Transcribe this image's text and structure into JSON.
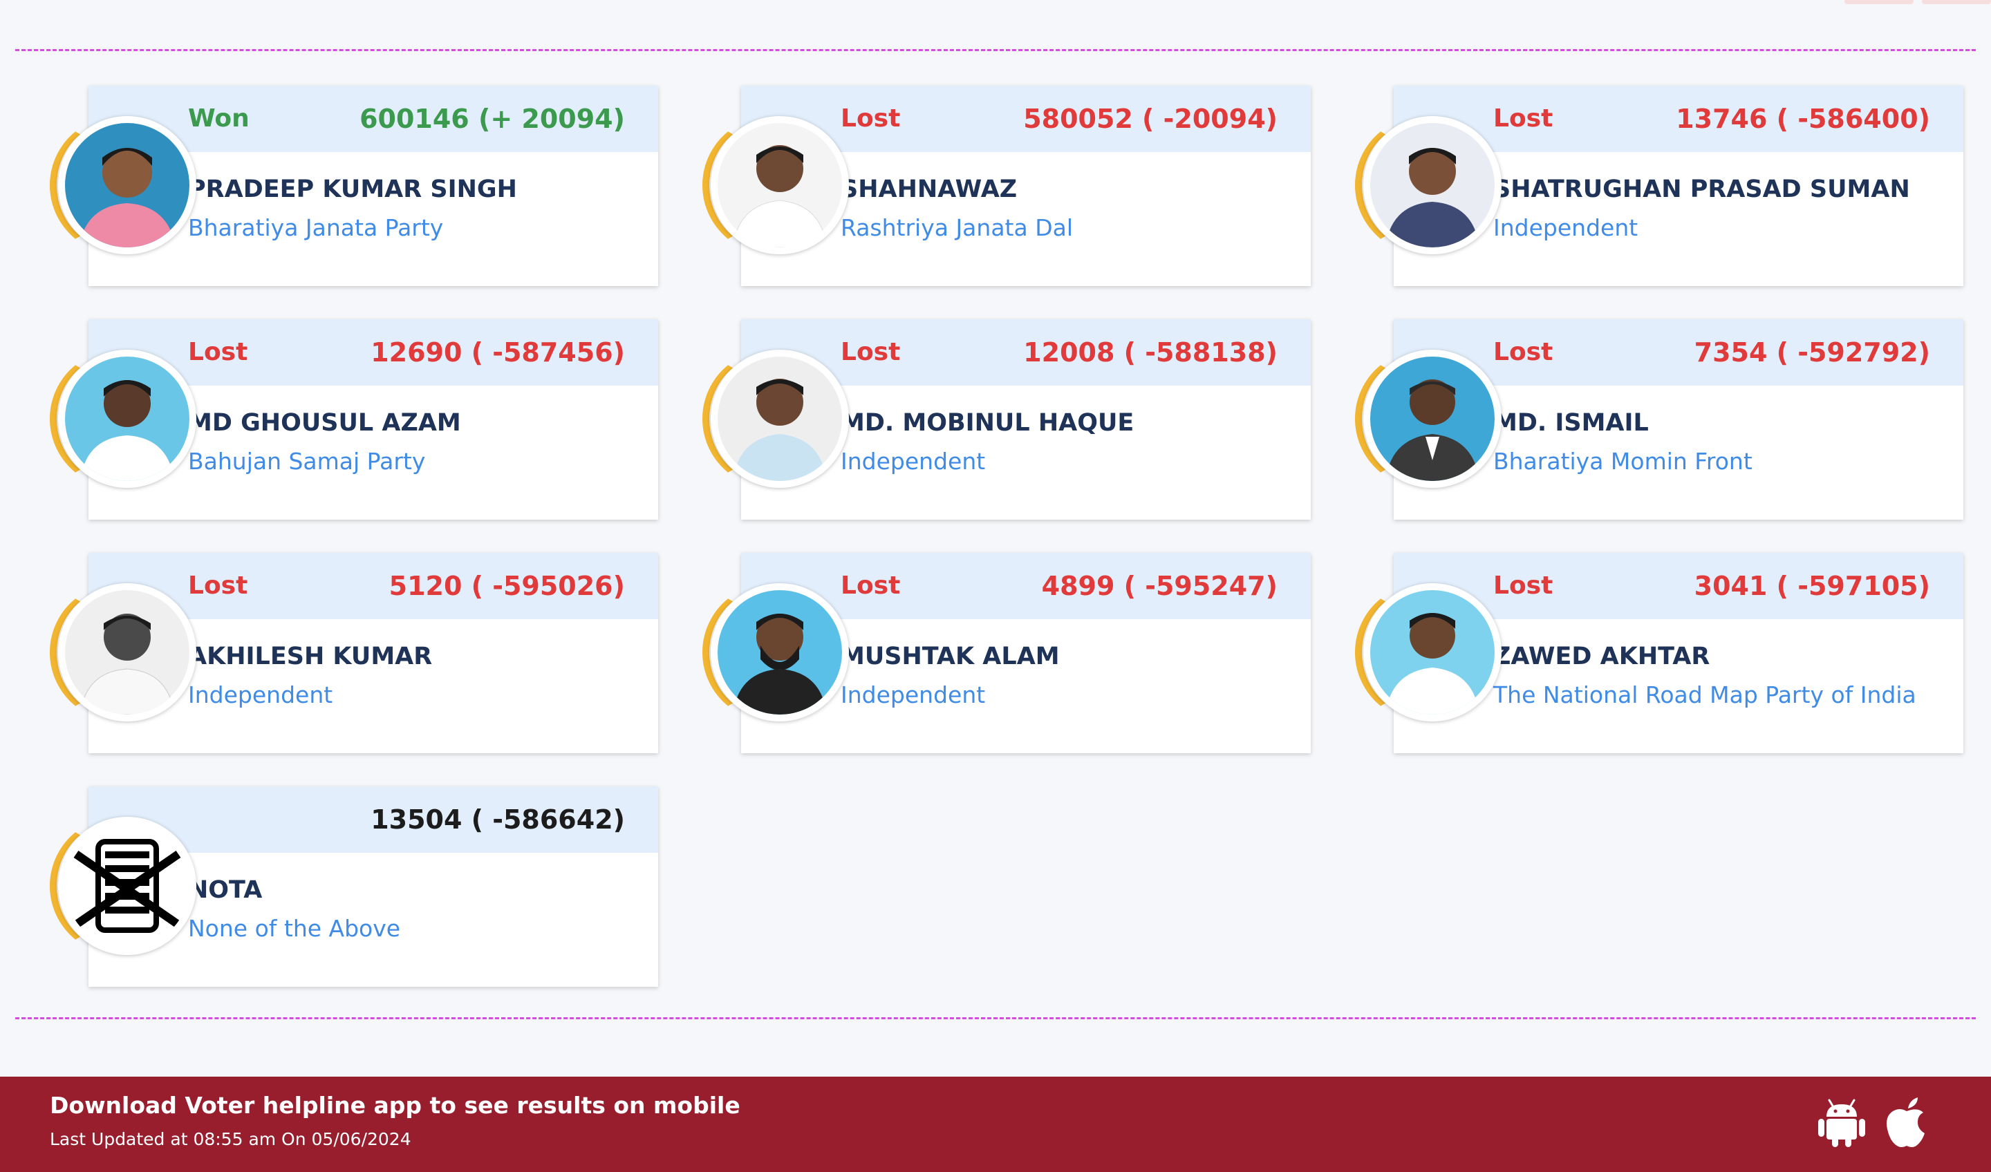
{
  "footer": {
    "message": "Download Voter helpline app to see results on mobile",
    "last_updated": "Last Updated at 08:55 am On 05/06/2024",
    "android_icon": "android-icon",
    "apple_icon": "apple-icon"
  },
  "colors": {
    "won": "#3c9a4e",
    "lost": "#e03a3a",
    "party": "#3f8be6",
    "name": "#1e3357",
    "card_header": "#e2eefb",
    "ring": "#f2b52f",
    "divider": "#d64be0",
    "footer_bg": "#981e2e"
  },
  "candidates": [
    {
      "status": "Won",
      "votes": "600146 (+ 20094)",
      "name": "PRADEEP KUMAR SINGH",
      "party": "Bharatiya Janata Party"
    },
    {
      "status": "Lost",
      "votes": "580052 ( -20094)",
      "name": "SHAHNAWAZ",
      "party": "Rashtriya Janata Dal"
    },
    {
      "status": "Lost",
      "votes": "13746 ( -586400)",
      "name": "SHATRUGHAN PRASAD SUMAN",
      "party": "Independent"
    },
    {
      "status": "Lost",
      "votes": "12690 ( -587456)",
      "name": "MD GHOUSUL AZAM",
      "party": "Bahujan Samaj Party"
    },
    {
      "status": "Lost",
      "votes": "12008 ( -588138)",
      "name": "MD. MOBINUL HAQUE",
      "party": "Independent"
    },
    {
      "status": "Lost",
      "votes": "7354 ( -592792)",
      "name": "MD. ISMAIL",
      "party": "Bharatiya Momin Front"
    },
    {
      "status": "Lost",
      "votes": "5120 ( -595026)",
      "name": "AKHILESH KUMAR",
      "party": "Independent"
    },
    {
      "status": "Lost",
      "votes": "4899 ( -595247)",
      "name": "MUSHTAK ALAM",
      "party": "Independent"
    },
    {
      "status": "Lost",
      "votes": "3041 ( -597105)",
      "name": "ZAWED AKHTAR",
      "party": "The National Road Map Party of India"
    },
    {
      "status": "",
      "votes": "13504 ( -586642)",
      "name": "NOTA",
      "party": "None of the Above"
    }
  ]
}
